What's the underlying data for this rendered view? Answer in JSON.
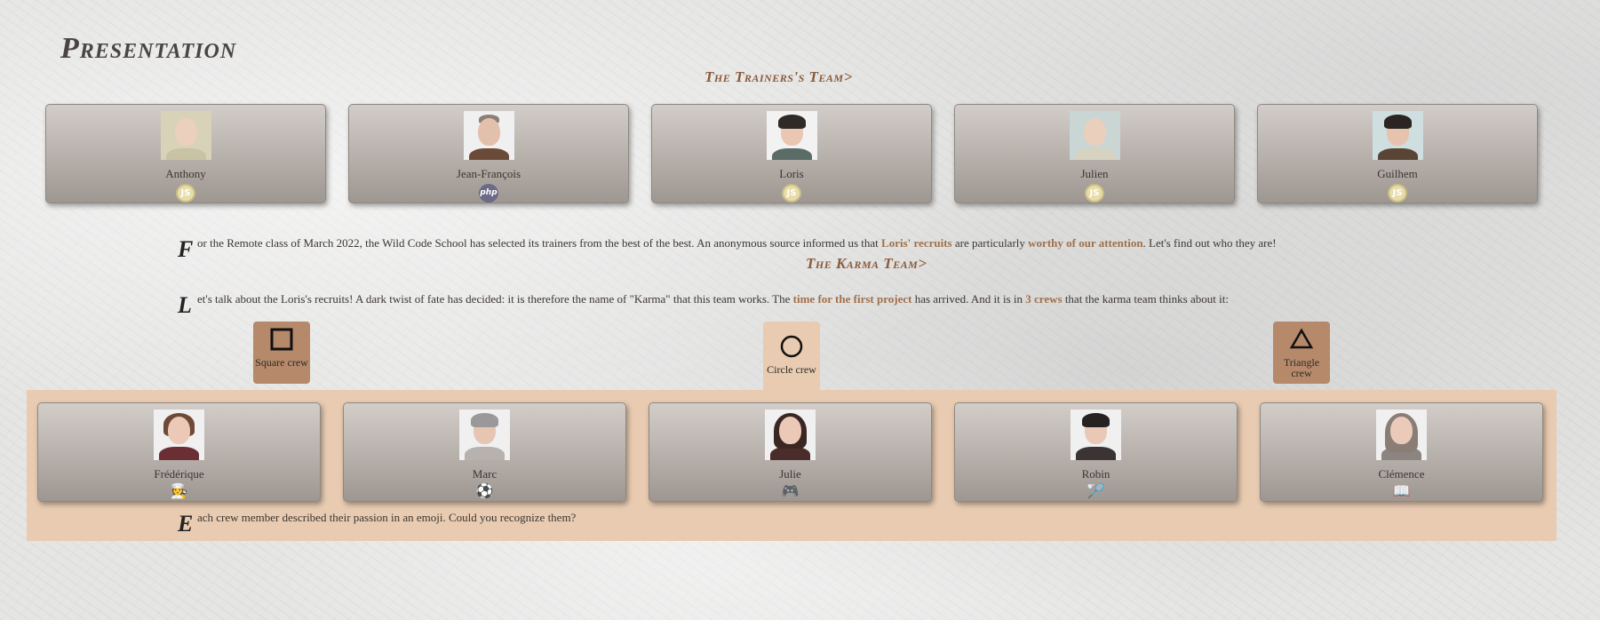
{
  "page_title": "Presentation",
  "trainers_title": "The Trainers's Team>",
  "karma_title": "The Karma Team>",
  "trainers": [
    {
      "name": "Anthony",
      "tech": "JS",
      "tech_icon": "js-icon"
    },
    {
      "name": "Jean-François",
      "tech": "php",
      "tech_icon": "php-icon"
    },
    {
      "name": "Loris",
      "tech": "JS",
      "tech_icon": "js-icon"
    },
    {
      "name": "Julien",
      "tech": "JS",
      "tech_icon": "js-icon"
    },
    {
      "name": "Guilhem",
      "tech": "JS",
      "tech_icon": "js-icon"
    }
  ],
  "intro": {
    "dropcap": "F",
    "part1": "or the Remote class of March 2022, the Wild Code School has selected its trainers from the best of the best. An anonymous source informed us that ",
    "hl1": "Loris' recruits",
    "part2": " are particularly ",
    "hl2": "worthy of our attention",
    "part3": ". Let's find out who they are!"
  },
  "karma": {
    "dropcap": "L",
    "part1": "et's talk about the Loris's recruits! A dark twist of fate has decided: it is therefore the name of \"Karma\" that this team works. The ",
    "hl1": "time for the first project",
    "part2": " has arrived. And it is in ",
    "hl2": "3 crews",
    "part3": " that the karma team thinks about it:"
  },
  "crews": [
    {
      "label": "Square crew",
      "icon": "square-icon"
    },
    {
      "label": "Circle crew",
      "icon": "circle-icon",
      "active": true
    },
    {
      "label": "Triangle crew",
      "icon": "triangle-icon"
    }
  ],
  "members": [
    {
      "name": "Frédérique",
      "emoji": "🧑‍🍳",
      "emoji_icon": "chef-icon"
    },
    {
      "name": "Marc",
      "emoji": "⚽",
      "emoji_icon": "sports-balls-icon"
    },
    {
      "name": "Julie",
      "emoji": "🎮",
      "emoji_icon": "game-controller-icon"
    },
    {
      "name": "Robin",
      "emoji": "🏸",
      "emoji_icon": "badminton-icon"
    },
    {
      "name": "Clémence",
      "emoji": "📖",
      "emoji_icon": "book-icon"
    }
  ],
  "outro": {
    "dropcap": "E",
    "text": "ach crew member described their passion in an emoji. Could you recognize them?"
  },
  "colors": {
    "accent": "#a0704a",
    "crew_band": "#e8cbb1",
    "crew_tab": "#b5896a"
  }
}
